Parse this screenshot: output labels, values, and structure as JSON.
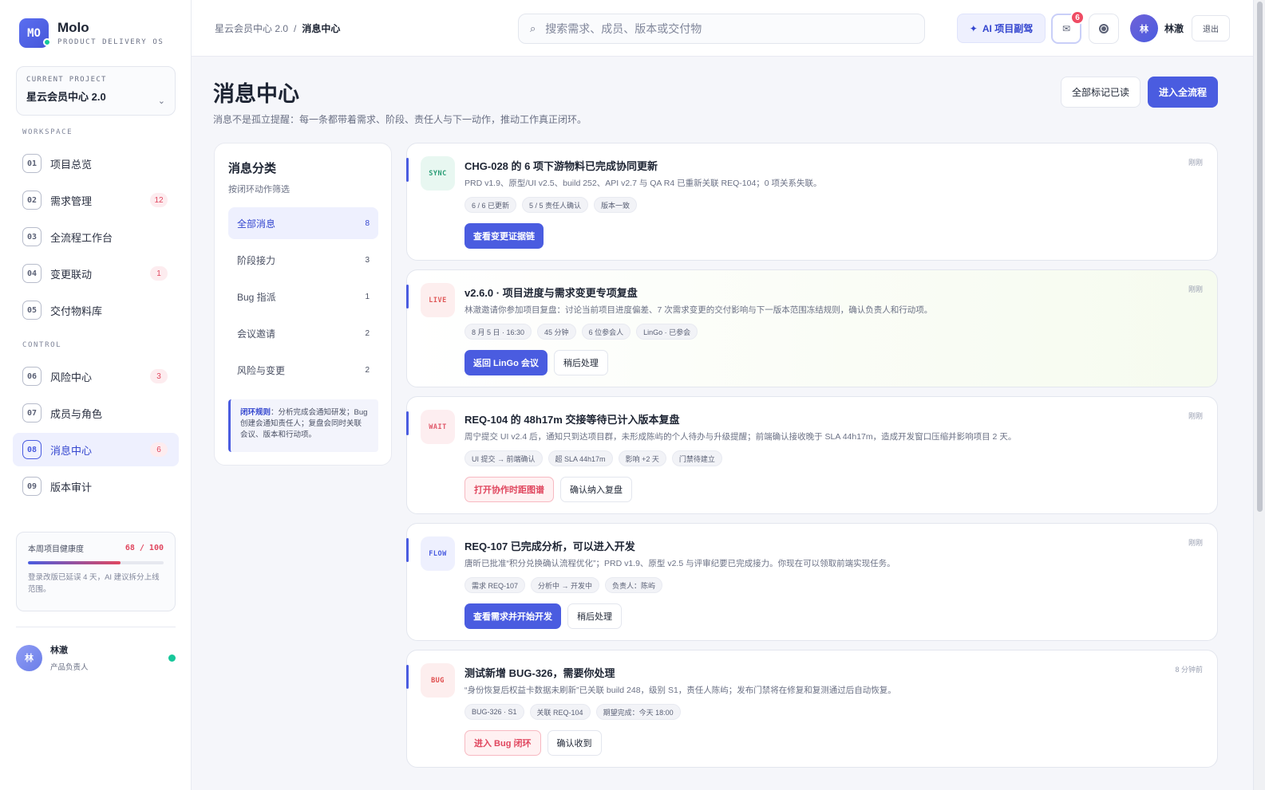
{
  "brand": {
    "logo": "MO",
    "name": "Molo",
    "tagline": "PRODUCT DELIVERY OS"
  },
  "project": {
    "label": "CURRENT PROJECT",
    "name": "星云会员中心 2.0",
    "chevron": "⌄"
  },
  "sidebar": {
    "workspace_label": "WORKSPACE",
    "control_label": "CONTROL",
    "items": [
      {
        "num": "01",
        "label": "项目总览",
        "badge": ""
      },
      {
        "num": "02",
        "label": "需求管理",
        "badge": "12"
      },
      {
        "num": "03",
        "label": "全流程工作台",
        "badge": ""
      },
      {
        "num": "04",
        "label": "变更联动",
        "badge": "1"
      },
      {
        "num": "05",
        "label": "交付物料库",
        "badge": ""
      },
      {
        "num": "06",
        "label": "风险中心",
        "badge": "3"
      },
      {
        "num": "07",
        "label": "成员与角色",
        "badge": ""
      },
      {
        "num": "08",
        "label": "消息中心",
        "badge": "6"
      },
      {
        "num": "09",
        "label": "版本审计",
        "badge": ""
      }
    ],
    "active_index": 7
  },
  "health": {
    "label": "本周项目健康度",
    "score": "68 / 100",
    "value": 68,
    "max": 100,
    "note": "登录改版已延误 4 天，AI 建议拆分上线范围。"
  },
  "user": {
    "avatar": "林",
    "name": "林澈",
    "role": "产品负责人"
  },
  "topbar": {
    "breadcrumb_root": "星云会员中心 2.0",
    "breadcrumb_sep": "/",
    "breadcrumb_current": "消息中心",
    "search_placeholder": "搜索需求、成员、版本或交付物",
    "search_icon": "⌕",
    "ai_label": "AI 项目副驾",
    "ai_icon": "✦",
    "mail_icon": "✉",
    "mail_badge": "6",
    "user_avatar": "林",
    "user_name": "林澈",
    "logout": "退出"
  },
  "page": {
    "title": "消息中心",
    "subtitle": "消息不是孤立提醒：每一条都带着需求、阶段、责任人与下一动作，推动工作真正闭环。",
    "mark_all_read": "全部标记已读",
    "enter_flow": "进入全流程"
  },
  "categories": {
    "title": "消息分类",
    "subtitle": "按闭环动作筛选",
    "items": [
      {
        "label": "全部消息",
        "count": "8"
      },
      {
        "label": "阶段接力",
        "count": "3"
      },
      {
        "label": "Bug 指派",
        "count": "1"
      },
      {
        "label": "会议邀请",
        "count": "2"
      },
      {
        "label": "风险与变更",
        "count": "2"
      }
    ],
    "active_index": 0,
    "rule_head": "闭环规则",
    "rule_text": "：分析完成会通知研发；Bug 创建会通知责任人；复盘会同时关联会议、版本和行动项。"
  },
  "messages": [
    {
      "tag": "SYNC",
      "title": "CHG-028 的 6 项下游物料已完成协同更新",
      "desc": "PRD v1.9、原型/UI v2.5、build 252、API v2.7 与 QA R4 已重新关联 REQ-104；0 项关系失联。",
      "time": "刚刚",
      "chips": [
        "6 / 6 已更新",
        "5 / 5 责任人确认",
        "版本一致"
      ],
      "primary": "查看变更证据链",
      "secondary": ""
    },
    {
      "tag": "LIVE",
      "title": "v2.6.0 · 项目进度与需求变更专项复盘",
      "desc": "林澈邀请你参加项目复盘：讨论当前项目进度偏差、7 次需求变更的交付影响与下一版本范围冻结规则，确认负责人和行动项。",
      "time": "刚刚",
      "chips": [
        "8 月 5 日 · 16:30",
        "45 分钟",
        "6 位参会人",
        "LinGo · 已参会"
      ],
      "primary": "返回 LinGo 会议",
      "secondary": "稍后处理"
    },
    {
      "tag": "WAIT",
      "title": "REQ-104 的 48h17m 交接等待已计入版本复盘",
      "desc": "周宁提交 UI v2.4 后，通知只到达项目群，未形成陈屿的个人待办与升级提醒；前端确认接收晚于 SLA 44h17m，造成开发窗口压缩并影响项目 2 天。",
      "time": "刚刚",
      "chips": [
        "UI 提交 → 前端确认",
        "超 SLA 44h17m",
        "影响 +2 天",
        "门禁待建立"
      ],
      "primary": "打开协作时距图谱",
      "secondary": "确认纳入复盘"
    },
    {
      "tag": "FLOW",
      "title": "REQ-107 已完成分析，可以进入开发",
      "desc": "唐昕已批准“积分兑换确认流程优化”；PRD v1.9、原型 v2.5 与评审纪要已完成接力。你现在可以领取前端实现任务。",
      "time": "刚刚",
      "chips": [
        "需求 REQ-107",
        "分析中 → 开发中",
        "负责人：陈屿"
      ],
      "primary": "查看需求并开始开发",
      "secondary": "稍后处理"
    },
    {
      "tag": "BUG",
      "title": "测试新增 BUG-326，需要你处理",
      "desc": "“身份恢复后权益卡数据未刷新”已关联 build 248，级别 S1，责任人陈屿；发布门禁将在修复和复测通过后自动恢复。",
      "time": "8 分钟前",
      "chips": [
        "BUG-326 · S1",
        "关联 REQ-104",
        "期望完成：今天 18:00"
      ],
      "primary": "进入 Bug 闭环",
      "secondary": "确认收到"
    }
  ]
}
